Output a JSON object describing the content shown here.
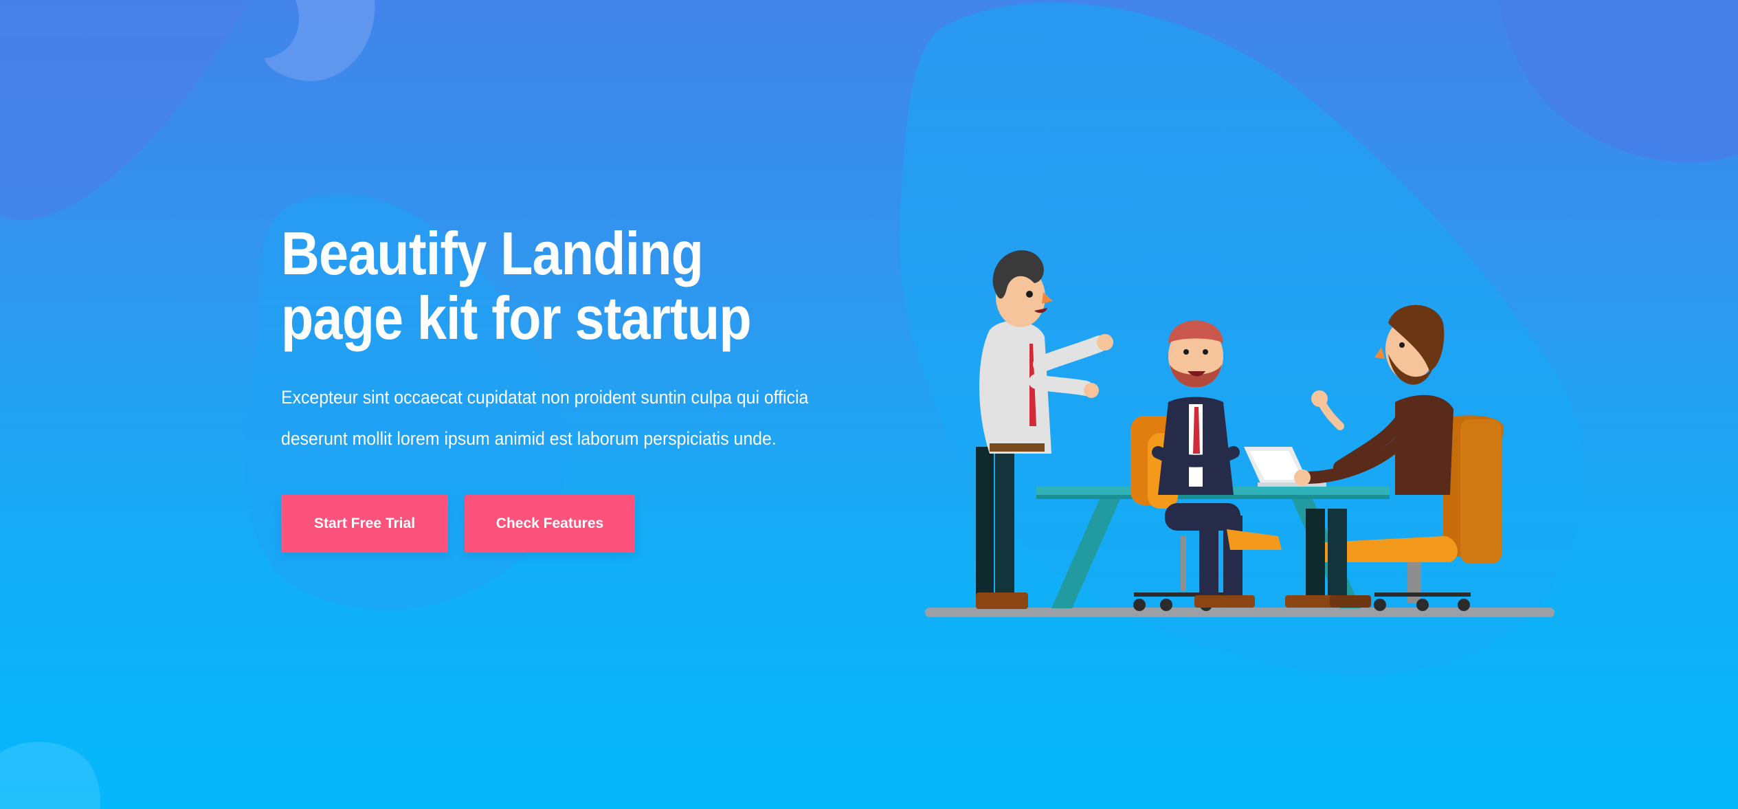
{
  "hero": {
    "title_line1": "Beautify Landing",
    "title_line2": "page kit for startup",
    "description_line1": "Excepteur sint occaecat cupidatat non proident suntin culpa qui officia",
    "description_line2": "deserunt mollit lorem ipsum animid est laborum perspiciatis unde."
  },
  "buttons": {
    "primary_label": "Start Free Trial",
    "secondary_label": "Check Features"
  },
  "colors": {
    "background_top": "#4284ea",
    "background_bottom": "#05b8fb",
    "button": "#fb537b",
    "text": "#ffffff"
  },
  "illustration": {
    "subject": "three businessmen meeting at a teal table with orange chairs and a laptop"
  }
}
